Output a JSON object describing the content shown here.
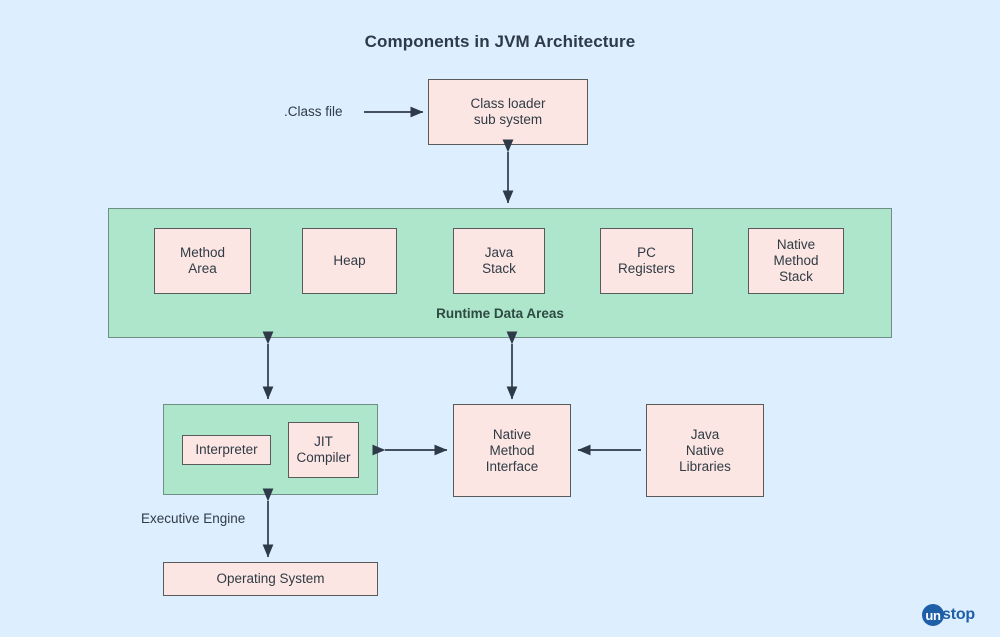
{
  "diagram": {
    "title": "Components in JVM Architecture",
    "background_color": "#ddeeff",
    "box_fill_color": "#fbe6e3",
    "panel_fill_color": "#ade6cb",
    "border_color": "#5a5a5a",
    "text_color": "#303b45"
  },
  "input_label": ".Class file",
  "class_loader": {
    "label": "Class loader\nsub system"
  },
  "runtime_data_areas": {
    "panel_label": "Runtime Data Areas",
    "boxes": [
      {
        "label": "Method\nArea"
      },
      {
        "label": "Heap"
      },
      {
        "label": "Java\nStack"
      },
      {
        "label": "PC\nRegisters"
      },
      {
        "label": "Native\nMethod\nStack"
      }
    ]
  },
  "executive_engine": {
    "panel_label": "Executive Engine",
    "boxes": [
      {
        "label": "Interpreter"
      },
      {
        "label": "JIT\nCompiler"
      }
    ]
  },
  "native_method_interface": {
    "label": "Native\nMethod\nInterface"
  },
  "java_native_libraries": {
    "label": "Java\nNative\nLibraries"
  },
  "operating_system": {
    "label": "Operating System"
  },
  "logo": {
    "mark": "un",
    "text": "stop",
    "color": "#1f5fa8"
  }
}
